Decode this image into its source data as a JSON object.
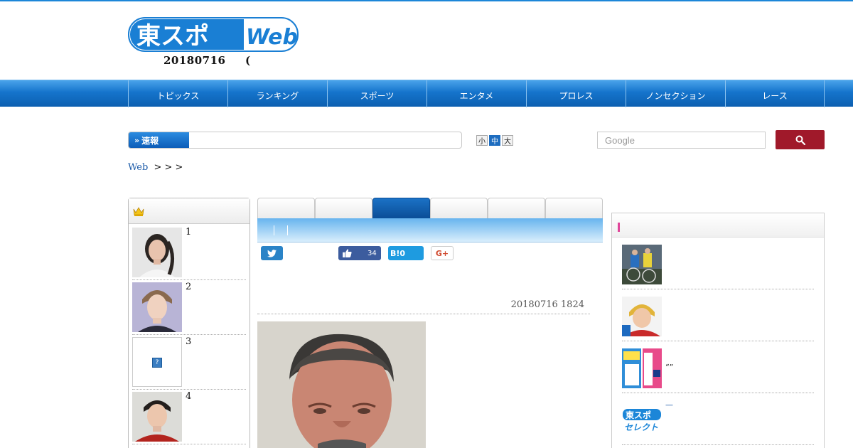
{
  "header": {
    "logo_text": "東スポWeb",
    "date_text": "20180716",
    "paren_text": "("
  },
  "nav": {
    "items": [
      {
        "label": "トピックス"
      },
      {
        "label": "ランキング"
      },
      {
        "label": "スポーツ"
      },
      {
        "label": "エンタメ"
      },
      {
        "label": "プロレス"
      },
      {
        "label": "ノンセクション"
      },
      {
        "label": "レース"
      }
    ]
  },
  "breaking": {
    "label": "速報"
  },
  "font_size": {
    "small": "小",
    "medium": "中",
    "large": "大",
    "selected": "中"
  },
  "search": {
    "placeholder": "Google",
    "button_icon": "search-icon"
  },
  "breadcrumb": {
    "home": "Web",
    "separators": ">  >  >"
  },
  "ranking": {
    "icon": "crown-icon",
    "items": [
      {
        "rank": "1"
      },
      {
        "rank": "2"
      },
      {
        "rank": "3",
        "thumb_missing_label": "?"
      },
      {
        "rank": "4"
      }
    ]
  },
  "article": {
    "active_tab_index": 3,
    "tab_count": 6,
    "share": {
      "twitter_icon": "twitter-icon",
      "like_count": "34",
      "hatena_label": "B!0",
      "gplus_label": "G+"
    },
    "timestamp": "20180716 1824"
  },
  "sidebar": {
    "news": [
      {
        "text": ""
      },
      {
        "text": ""
      },
      {
        "text": "“”"
      },
      {
        "text": "—",
        "logo_text": "東スポセレクト"
      }
    ]
  },
  "colors": {
    "brand_blue": "#1574cc",
    "nav_dark": "#0c5fb0",
    "search_button": "#a0192a",
    "accent_pink": "#e0469a",
    "twitter": "#2a83c7",
    "facebook": "#3c5c9e",
    "hatena": "#1e9be0"
  }
}
